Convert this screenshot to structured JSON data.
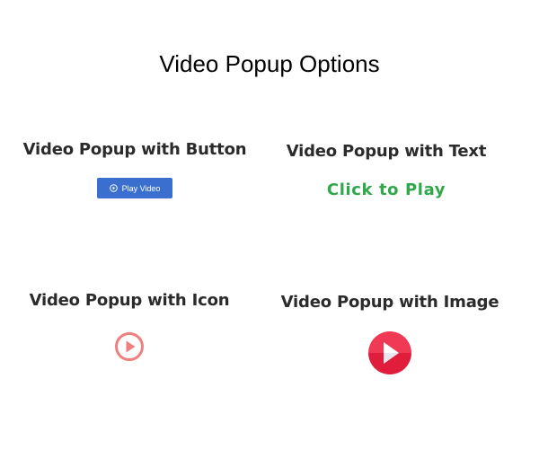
{
  "page": {
    "title": "Video Popup Options"
  },
  "sections": {
    "button": {
      "heading": "Video Popup with Button",
      "button_label": "Play Video"
    },
    "text": {
      "heading": "Video Popup with Text",
      "link_text": "Click to Play"
    },
    "icon": {
      "heading": "Video Popup with Icon",
      "icon_name": "play-circle-outline-icon"
    },
    "image": {
      "heading": "Video Popup with Image",
      "icon_name": "play-circle-filled-icon"
    }
  },
  "colors": {
    "button_bg": "#3a6fcf",
    "text_link": "#2ea84a",
    "icon_outline": "#f08080",
    "image_top": "#f03a55",
    "image_bottom": "#e01e3c"
  }
}
